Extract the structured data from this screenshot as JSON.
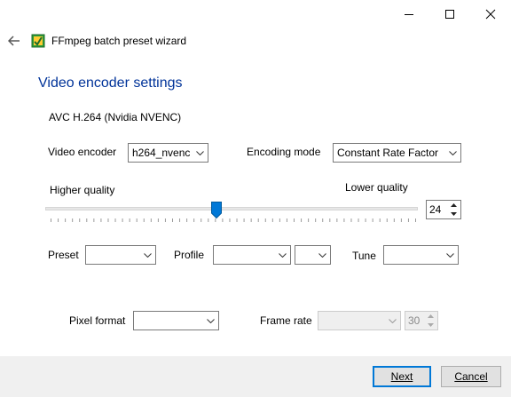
{
  "window": {
    "title": "FFmpeg batch preset wizard",
    "colors": {
      "accent": "#0078d7",
      "heading": "#003399",
      "footer_bg": "#f0f0f0"
    }
  },
  "page": {
    "heading": "Video encoder settings",
    "codec_name": "AVC H.264 (Nvidia NVENC)"
  },
  "encoder": {
    "label": "Video encoder",
    "value": "h264_nvenc"
  },
  "encoding_mode": {
    "label": "Encoding mode",
    "value": "Constant Rate Factor"
  },
  "quality": {
    "higher_label": "Higher quality",
    "lower_label": "Lower quality",
    "value": "24",
    "slider_position_fraction": 0.46
  },
  "preset": {
    "label": "Preset",
    "value": ""
  },
  "profile": {
    "label": "Profile",
    "value": "",
    "level_value": ""
  },
  "tune": {
    "label": "Tune",
    "value": ""
  },
  "pixel_format": {
    "label": "Pixel format",
    "value": ""
  },
  "frame_rate": {
    "label": "Frame rate",
    "value": "",
    "spinner_value": "30"
  },
  "footer": {
    "next_label": "Next",
    "cancel_label": "Cancel"
  }
}
